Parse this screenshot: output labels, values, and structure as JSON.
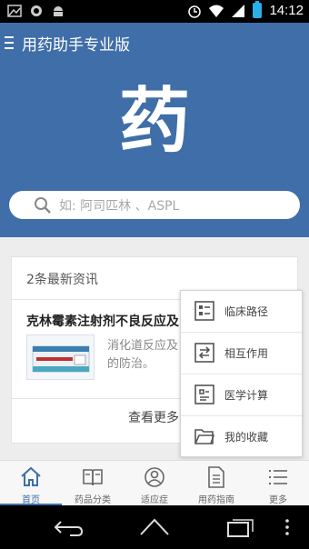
{
  "status_bar": {
    "time": "14:12"
  },
  "app_bar": {
    "title": "用药助手专业版"
  },
  "hero": {
    "logo_char": "药"
  },
  "search": {
    "placeholder": "如: 阿司匹林 、ASPL"
  },
  "news": {
    "header": "2条最新资讯",
    "item_title": "克林霉素注射剂不良反应及",
    "item_summary": "消化道反应及\n的防治。",
    "thumb_text": "克林霉素磷酸酯注射液",
    "more": "查看更多"
  },
  "popup_menu": {
    "items": [
      {
        "label": "临床路径",
        "icon": "clinical-path-icon"
      },
      {
        "label": "相互作用",
        "icon": "interaction-icon"
      },
      {
        "label": "医学计算",
        "icon": "calculator-icon"
      },
      {
        "label": "我的收藏",
        "icon": "folder-icon"
      }
    ]
  },
  "bottom_nav": {
    "items": [
      {
        "label": "首页",
        "icon": "home-icon",
        "active": true
      },
      {
        "label": "药品分类",
        "icon": "book-icon"
      },
      {
        "label": "适应症",
        "icon": "indication-icon"
      },
      {
        "label": "用药指南",
        "icon": "document-icon"
      },
      {
        "label": "更多",
        "icon": "list-icon"
      }
    ]
  },
  "colors": {
    "primary": "#3f6ea8",
    "battery": "#2ab0e8"
  }
}
